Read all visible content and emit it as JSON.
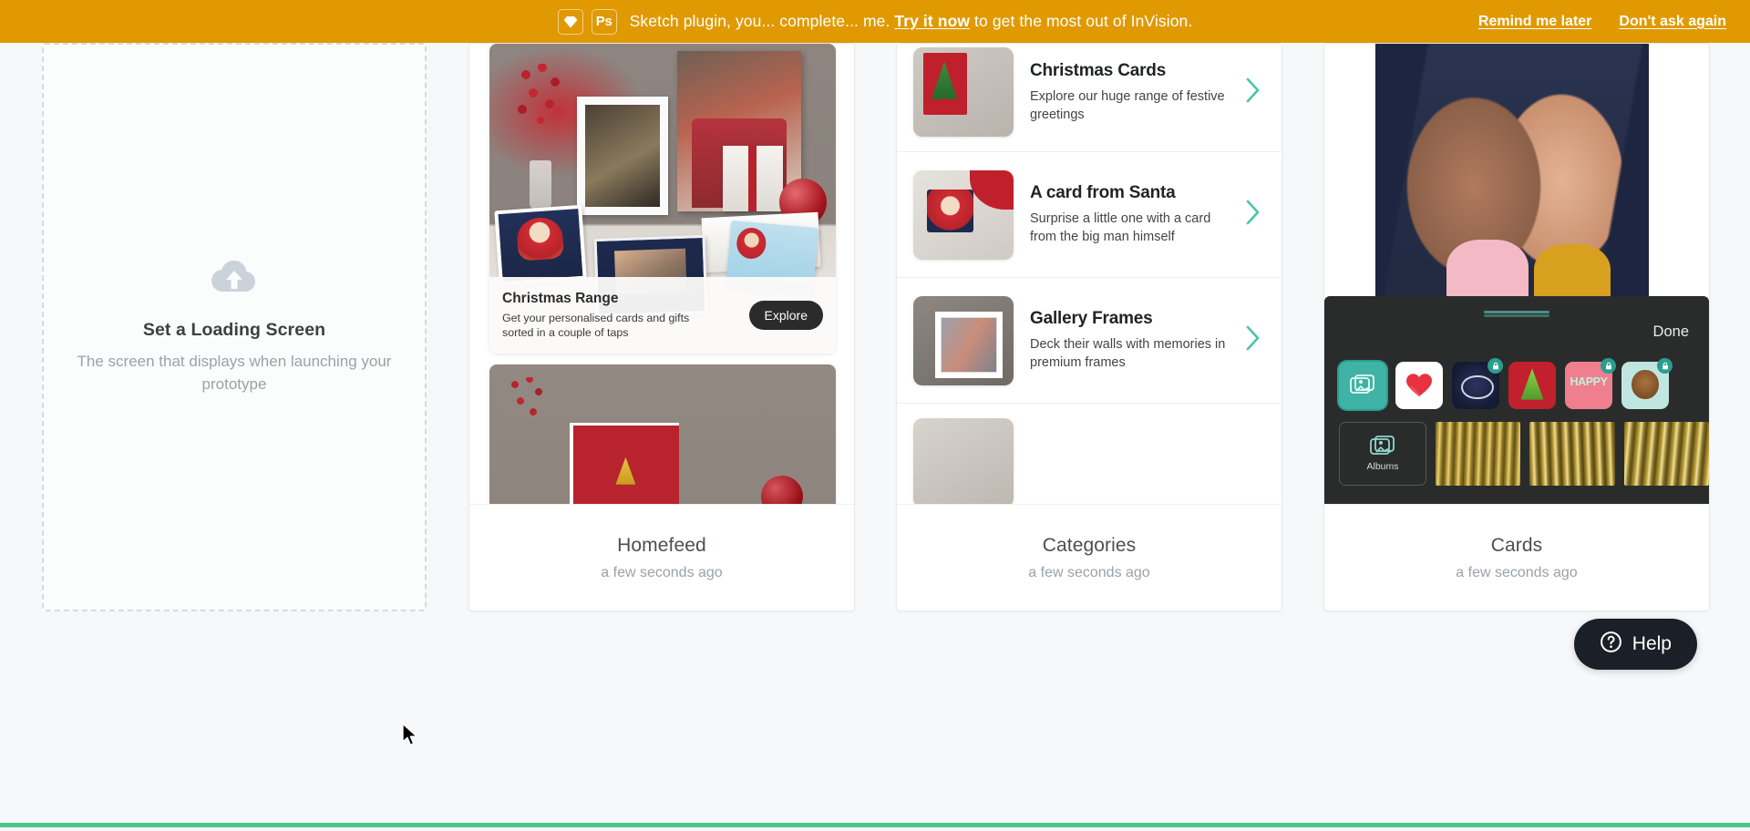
{
  "banner": {
    "sketch_icon": "sketch-diamond-icon",
    "photoshop_label": "Ps",
    "message_prefix": "Sketch plugin, you... complete... me. ",
    "link_label": "Try it now",
    "message_suffix": " to get the most out of InVision.",
    "remind_later": "Remind me later",
    "dont_ask": "Don't ask again",
    "background_color": "#e09900"
  },
  "loading_placeholder": {
    "icon": "cloud-upload-icon",
    "title": "Set a Loading Screen",
    "subtitle": "The screen that displays when launching your prototype"
  },
  "screens": [
    {
      "name": "Homefeed",
      "timestamp": "a few seconds ago",
      "hero_caption": {
        "title": "Christmas Range",
        "subtitle": "Get your personalised cards and gifts sorted in a couple of taps",
        "button": "Explore"
      }
    },
    {
      "name": "Categories",
      "timestamp": "a few seconds ago",
      "rows": [
        {
          "title": "Christmas Cards",
          "subtitle": "Explore our huge range of festive greetings",
          "chevron": "chevron-right-icon"
        },
        {
          "title": "A card from Santa",
          "subtitle": "Surprise a little one with a card from the big man himself",
          "chevron": "chevron-right-icon"
        },
        {
          "title": "Gallery Frames",
          "subtitle": "Deck their walls with memories in premium frames",
          "chevron": "chevron-right-icon"
        }
      ]
    },
    {
      "name": "Cards",
      "timestamp": "a few seconds ago",
      "sticker_sheet": {
        "done_label": "Done",
        "albums_label": "Albums",
        "stickers": [
          {
            "id": "photos-sticker",
            "locked": false,
            "selected": true,
            "label": ""
          },
          {
            "id": "heart-sticker",
            "locked": false,
            "selected": false,
            "label": ""
          },
          {
            "id": "merry-christmas-wreath-sticker",
            "locked": true,
            "selected": false,
            "label": ""
          },
          {
            "id": "christmas-tree-sticker",
            "locked": false,
            "selected": false,
            "label": ""
          },
          {
            "id": "happy-birthday-sticker",
            "locked": true,
            "selected": false,
            "label": "HAPPY"
          },
          {
            "id": "bear-sticker",
            "locked": true,
            "selected": false,
            "label": ""
          }
        ]
      }
    }
  ],
  "help": {
    "label": "Help",
    "icon": "question-circle-icon"
  },
  "colors": {
    "banner": "#e09900",
    "accent_green": "#50c589",
    "chevron_teal": "#47c5ab",
    "dark_pill": "#1b1f27"
  }
}
